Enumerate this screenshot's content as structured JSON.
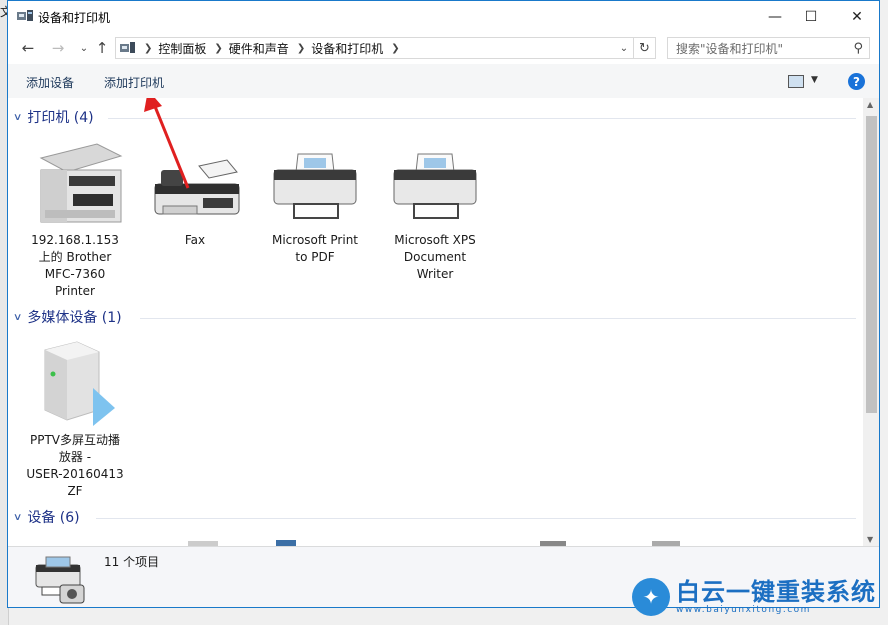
{
  "background_char": "文",
  "window": {
    "title": "设备和打印机",
    "controls": {
      "minimize": "—",
      "maximize": "☐",
      "close": "✕"
    }
  },
  "nav": {
    "back": "←",
    "forward": "→",
    "up": "↑",
    "breadcrumb": [
      "控制面板",
      "硬件和声音",
      "设备和打印机"
    ],
    "refresh": "↻",
    "search_placeholder": "搜索\"设备和打印机\""
  },
  "commands": {
    "add_device": "添加设备",
    "add_printer": "添加打印机"
  },
  "groups": [
    {
      "heading": "打印机 (4)"
    },
    {
      "heading": "多媒体设备 (1)"
    },
    {
      "heading": "设备 (6)"
    }
  ],
  "printers": [
    {
      "label": "192.168.1.153\n上的 Brother\nMFC-7360\nPrinter",
      "icon": "multifunction-printer-icon"
    },
    {
      "label": "Fax",
      "icon": "fax-icon"
    },
    {
      "label": "Microsoft Print\nto PDF",
      "icon": "printer-icon"
    },
    {
      "label": "Microsoft XPS\nDocument\nWriter",
      "icon": "printer-icon"
    }
  ],
  "media": [
    {
      "label": "PPTV多屏互动播\n放器 -\nUSER-20160413\nZF",
      "icon": "media-server-icon"
    }
  ],
  "details": {
    "count": "11 个项目"
  },
  "watermark": {
    "brand": "白云一键重装系统",
    "url": "www.baiyunxitong.com"
  },
  "colors": {
    "accent": "#1979ca",
    "group_heading": "#1e3287",
    "annotation_arrow": "#e02020"
  }
}
